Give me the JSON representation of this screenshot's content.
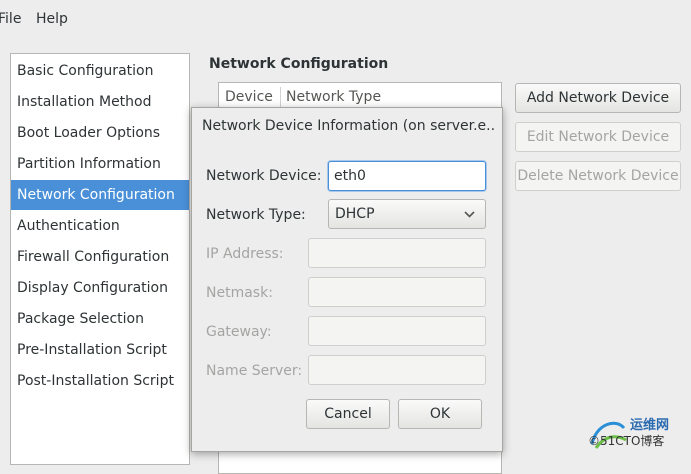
{
  "menubar": {
    "items": [
      "File",
      "Help"
    ]
  },
  "sidebar": {
    "items": [
      "Basic Configuration",
      "Installation Method",
      "Boot Loader Options",
      "Partition Information",
      "Network Configuration",
      "Authentication",
      "Firewall Configuration",
      "Display Configuration",
      "Package Selection",
      "Pre-Installation Script",
      "Post-Installation Script"
    ],
    "selected": "Network Configuration"
  },
  "main": {
    "title": "Network Configuration",
    "columns": [
      "Device",
      "Network Type"
    ],
    "buttons": {
      "add": "Add Network Device",
      "edit": "Edit Network Device",
      "delete": "Delete Network Device"
    }
  },
  "dialog": {
    "title": "Network Device Information (on server.e...",
    "device_label": "Network Device:",
    "device_value": "eth0",
    "type_label": "Network Type:",
    "type_value": "DHCP",
    "ip_label": "IP Address:",
    "netmask_label": "Netmask:",
    "gateway_label": "Gateway:",
    "nameserver_label": "Name Server:",
    "cancel_label": "Cancel",
    "ok_label": "OK"
  },
  "watermark": {
    "line1": "运维网",
    "line2": "©51CTO博客"
  },
  "colors": {
    "selection": "#4a90d9",
    "focus": "#4a90d9"
  }
}
